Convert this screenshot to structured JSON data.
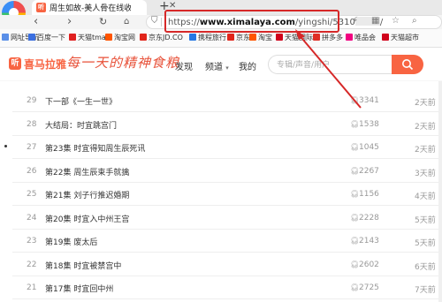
{
  "browser": {
    "tab_title": "周生如故-美人骨在线收听-喜马",
    "tab_favicon": "听",
    "new_tab": "+",
    "url_prefix": "https://",
    "url_domain": "www.ximalaya.com",
    "url_path": "/yingshi/5310",
    "url_tail": "/"
  },
  "bookmarks": [
    {
      "label": "网址导航",
      "color": "#5a8fe8"
    },
    {
      "label": "百度一下",
      "color": "#3b6fe0"
    },
    {
      "label": "天猫tmall",
      "color": "#e02020"
    },
    {
      "label": "淘宝网",
      "color": "#ff5500"
    },
    {
      "label": "京东JD.CO",
      "color": "#e1251b"
    },
    {
      "label": "携程旅行",
      "color": "#2577e3"
    },
    {
      "label": "京东",
      "color": "#e1251b"
    },
    {
      "label": "淘宝",
      "color": "#ff5500"
    },
    {
      "label": "天猫国际",
      "color": "#d0021b"
    },
    {
      "label": "拼多多",
      "color": "#e02e24"
    },
    {
      "label": "唯品会",
      "color": "#f10180"
    },
    {
      "label": "天猫超市",
      "color": "#d0021b"
    }
  ],
  "site": {
    "logo_mark": "听",
    "logo_text": "喜马拉雅",
    "slogan": "每一天的精神食粮",
    "nav": {
      "discover": "发现",
      "channel": "频道",
      "mine": "我的"
    },
    "search_placeholder": "专辑/声音/用户"
  },
  "tracks": [
    {
      "num": "29",
      "title": "下一部《一生一世》",
      "plays": "3341",
      "date": "2天前"
    },
    {
      "num": "28",
      "title": "大结局：时宜跳宫门",
      "plays": "1538",
      "date": "2天前"
    },
    {
      "num": "27",
      "title": "第23集 时宜得知周生辰死讯",
      "plays": "1045",
      "date": "2天前"
    },
    {
      "num": "26",
      "title": "第22集 周生辰束手就擒",
      "plays": "2267",
      "date": "3天前"
    },
    {
      "num": "25",
      "title": "第21集 刘子行推迟婚期",
      "plays": "1156",
      "date": "4天前"
    },
    {
      "num": "24",
      "title": "第20集 时宜入中州王宫",
      "plays": "2228",
      "date": "5天前"
    },
    {
      "num": "23",
      "title": "第19集 废太后",
      "plays": "2143",
      "date": "5天前"
    },
    {
      "num": "22",
      "title": "第18集 时宜被禁宫中",
      "plays": "2602",
      "date": "6天前"
    },
    {
      "num": "21",
      "title": "第17集 时宜回中州",
      "plays": "2725",
      "date": "7天前"
    }
  ],
  "colors": {
    "brand": "#f86442",
    "highlight": "#d62828"
  }
}
